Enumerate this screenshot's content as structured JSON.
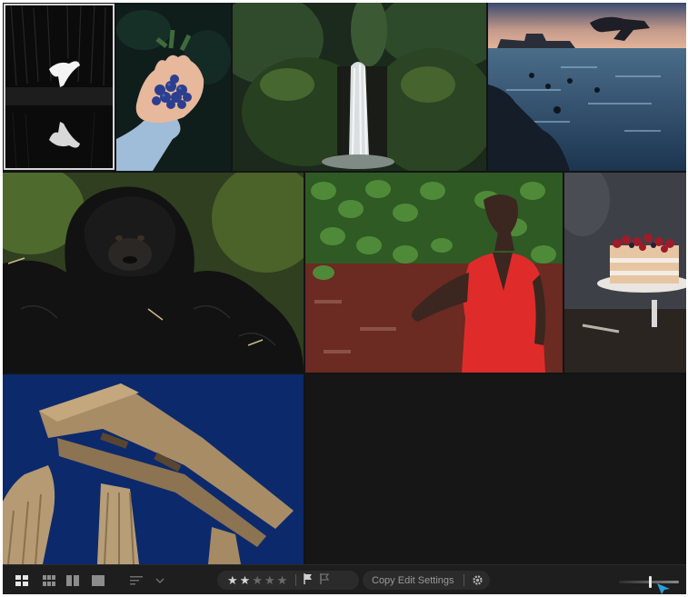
{
  "photos": [
    {
      "id": "egret",
      "subject": "white egret reflected in dark water"
    },
    {
      "id": "blueberries",
      "subject": "hand holding blueberries"
    },
    {
      "id": "waterfall",
      "subject": "forest waterfall"
    },
    {
      "id": "sea-jump",
      "subject": "person jumping into sea at dusk"
    },
    {
      "id": "gorilla",
      "subject": "young gorilla"
    },
    {
      "id": "woman-red-dress",
      "subject": "woman in red dress against ivy wall"
    },
    {
      "id": "cake",
      "subject": "berry layer cake on stand"
    },
    {
      "id": "temple",
      "subject": "greek temple columns against blue sky"
    }
  ],
  "toolbar": {
    "view_modes": [
      "grid-view-icon",
      "square-grid-icon",
      "detail-view-icon",
      "single-view-icon"
    ],
    "sort_icon": "sort-icon",
    "rating": {
      "value": 2,
      "max": 5
    },
    "flag_icons": [
      "flag-pick-icon",
      "flag-reject-icon"
    ],
    "copy_edit_settings": "Copy Edit Settings",
    "settings_icon": "gear-icon",
    "zoom_level": 0.5
  },
  "colors": {
    "background": "#141414",
    "toolbar": "#1e1e1e",
    "cursor_accent": "#2b9fd9"
  }
}
